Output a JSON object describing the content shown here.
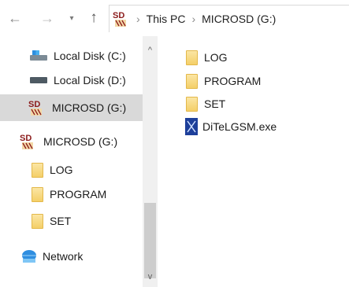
{
  "toolbar": {
    "back_icon": "←",
    "forward_icon": "→",
    "recent_icon": "⌄",
    "up_icon": "↑",
    "crumb_sep": "›",
    "crumbs": [
      "This PC",
      "MICROSD (G:)"
    ]
  },
  "navpane": {
    "items": [
      {
        "label": "Local Disk (C:)",
        "icon": "drive-c-icon"
      },
      {
        "label": "Local Disk (D:)",
        "icon": "drive-d-icon"
      },
      {
        "label": "MICROSD (G:)",
        "icon": "sd-card-icon",
        "selected": true
      },
      {
        "label": "MICROSD (G:)",
        "icon": "sd-card-icon"
      },
      {
        "label": "LOG",
        "icon": "folder-icon"
      },
      {
        "label": "PROGRAM",
        "icon": "folder-icon"
      },
      {
        "label": "SET",
        "icon": "folder-icon"
      },
      {
        "label": "Network",
        "icon": "network-icon"
      }
    ],
    "scroll_up": "^",
    "scroll_down": "v"
  },
  "content": {
    "items": [
      {
        "label": "LOG",
        "icon": "folder-icon"
      },
      {
        "label": "PROGRAM",
        "icon": "folder-icon"
      },
      {
        "label": "SET",
        "icon": "folder-icon"
      },
      {
        "label": "DiTeLGSM.exe",
        "icon": "exe-icon"
      }
    ]
  },
  "colors": {
    "selection": "#d9d9d9",
    "folder": "#f4cf68",
    "sd_red": "#8b1a1a"
  }
}
